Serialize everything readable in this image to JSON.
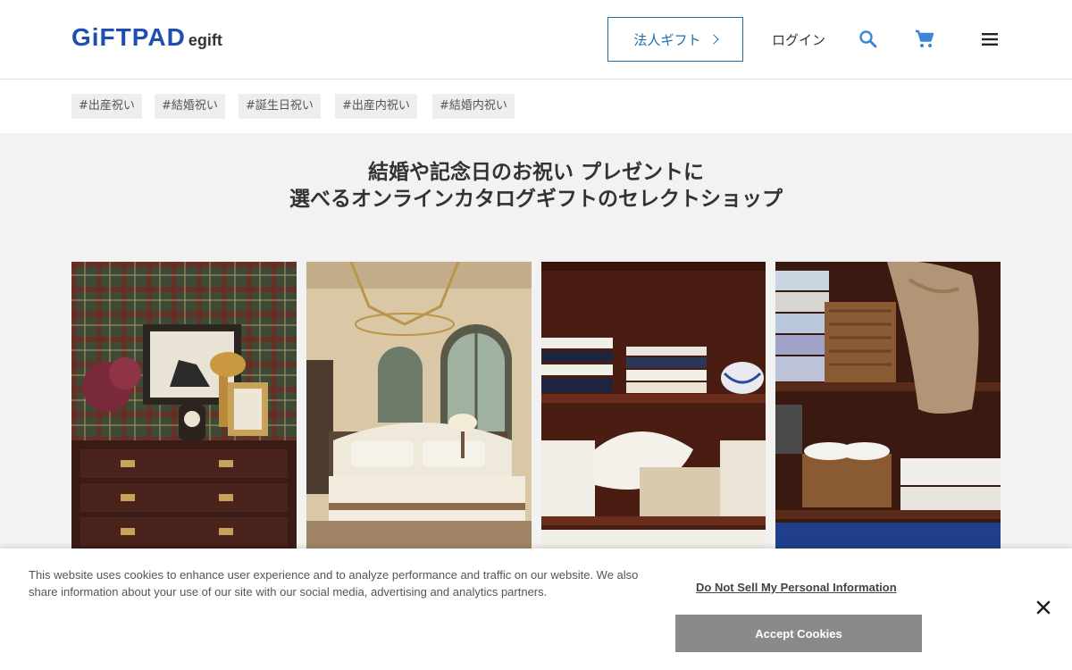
{
  "header": {
    "logo_main": "GiFTPAD",
    "logo_sub": "egift",
    "corporate_button": "法人ギフト",
    "login": "ログイン",
    "icons": [
      "search-icon",
      "cart-icon",
      "menu-icon"
    ],
    "accent_color": "#1f6fa8",
    "brand_color": "#1f4db0"
  },
  "tags": [
    "#出産祝い",
    "#結婚祝い",
    "#誕生日祝い",
    "#出産内祝い",
    "#結婚内祝い"
  ],
  "hero": {
    "title_line1": "結婚や記念日のお祝い プレゼントに",
    "title_line2": "選べるオンラインカタログギフトのセレクトショップ"
  },
  "cookie_banner": {
    "text": "This website uses cookies to enhance user experience and to analyze performance and traffic on our website. We also share information about your use of our site with our social media, advertising and analytics partners.",
    "do_not_sell": "Do Not Sell My Personal Information",
    "accept": "Accept Cookies"
  }
}
